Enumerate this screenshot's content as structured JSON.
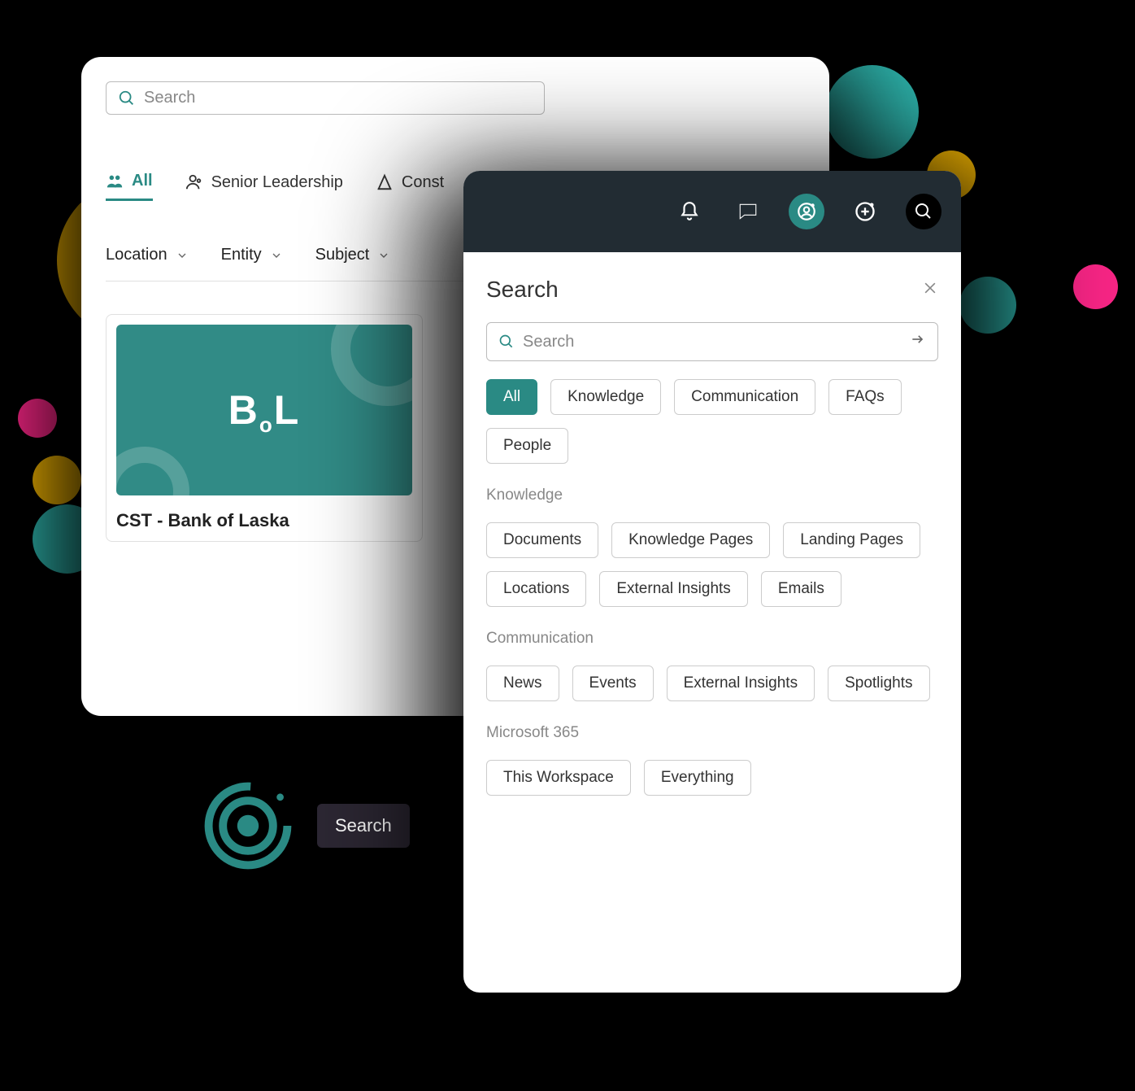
{
  "back": {
    "search_placeholder": "Search",
    "tabs": [
      {
        "label": "All"
      },
      {
        "label": "Senior Leadership"
      },
      {
        "label": "Const"
      }
    ],
    "filters": [
      {
        "label": "Location"
      },
      {
        "label": "Entity"
      },
      {
        "label": "Subject"
      }
    ],
    "card": {
      "logo": "B.L",
      "title": "CST - Bank of Laska"
    }
  },
  "badge": {
    "label": "Search"
  },
  "panel": {
    "title": "Search",
    "search_placeholder": "Search",
    "top_chips": [
      "All",
      "Knowledge",
      "Communication",
      "FAQs",
      "People"
    ],
    "sections": [
      {
        "label": "Knowledge",
        "chips": [
          "Documents",
          "Knowledge Pages",
          "Landing Pages",
          "Locations",
          "External Insights",
          "Emails"
        ]
      },
      {
        "label": "Communication",
        "chips": [
          "News",
          "Events",
          "External Insights",
          "Spotlights"
        ]
      },
      {
        "label": "Microsoft 365",
        "chips": [
          "This Workspace",
          "Everything"
        ]
      }
    ]
  }
}
